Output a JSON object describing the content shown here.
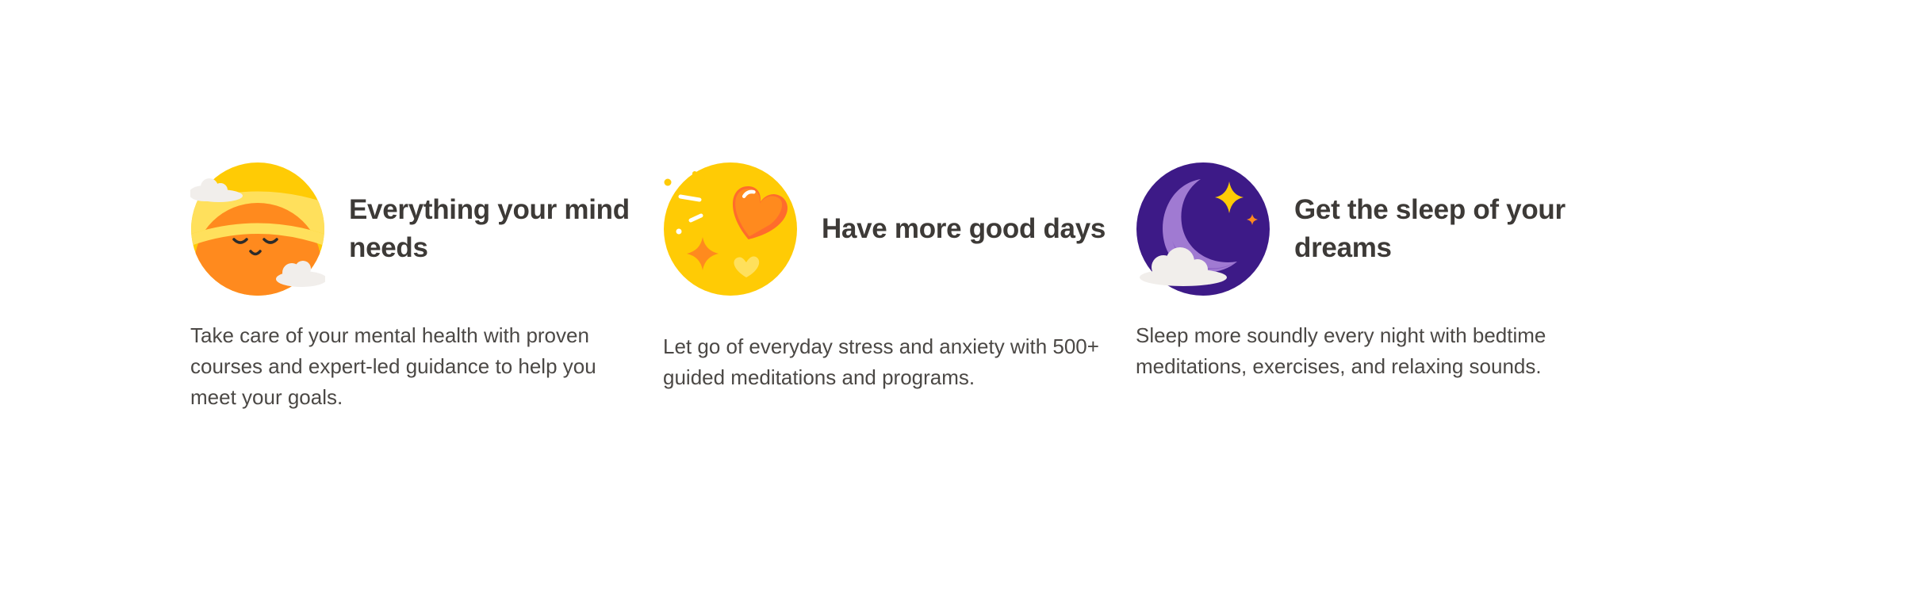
{
  "features": [
    {
      "icon": "sleeping-sun-icon",
      "title": "Everything your mind needs",
      "description": "Take care of your mental health with proven courses and expert-led guidance to help you meet your goals."
    },
    {
      "icon": "heart-sparkle-icon",
      "title": "Have more good days",
      "description": "Let go of everyday stress and anxiety with 500+ guided meditations and programs."
    },
    {
      "icon": "moon-stars-icon",
      "title": "Get the sleep of your dreams",
      "description": "Sleep more soundly every night with bedtime meditations, exercises, and relaxing sounds."
    }
  ],
  "colors": {
    "yellow": "#ffcb05",
    "light-yellow": "#ffe05c",
    "orange": "#ff8a1e",
    "deep-orange": "#ff6c2c",
    "purple": "#3d1a87",
    "lavender": "#a07ad2",
    "cloud": "#f1eeeb",
    "text": "#3d3a37"
  }
}
